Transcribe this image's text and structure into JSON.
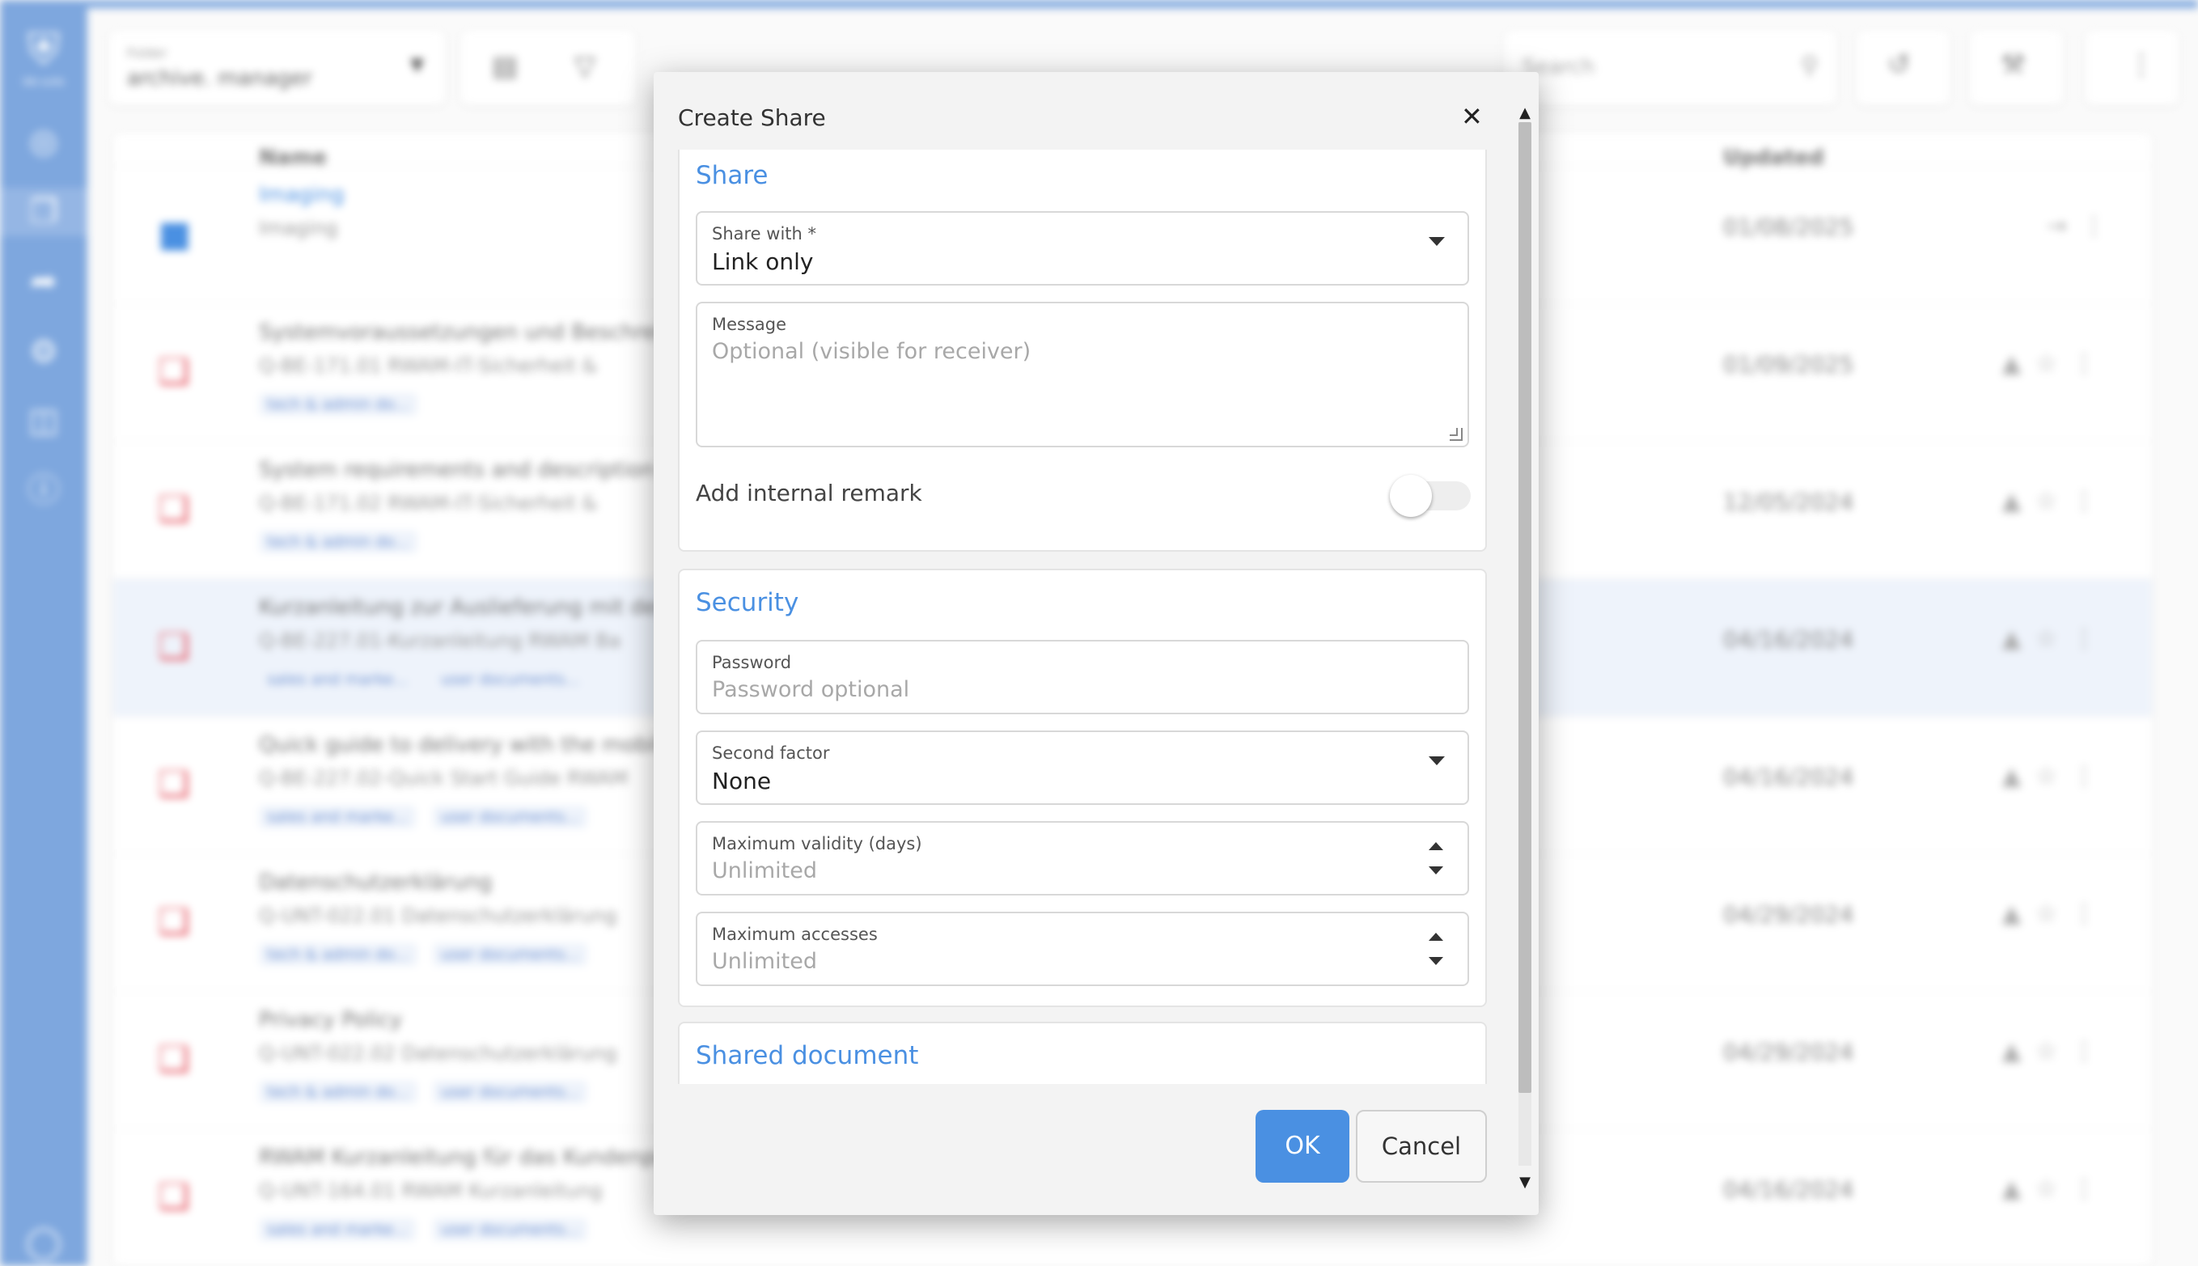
{
  "background": {
    "sidebar_logo_text": "ibb suite",
    "folder_label": "Folder",
    "folder_value": "archive. manager",
    "search_placeholder": "Search",
    "columns": {
      "name": "Name",
      "updated": "Updated"
    },
    "rows": [
      {
        "title": "Imaging",
        "subtitle": "Imaging",
        "date": "01/08/2025",
        "type": "folder",
        "tags": []
      },
      {
        "title": "Systemvoraussetzungen und Beschreibung",
        "subtitle": "Q-BE-171.01 RWAM-IT-Sicherheit &",
        "date": "01/09/2025",
        "type": "pdf",
        "tags": [
          "tech & admin do..."
        ]
      },
      {
        "title": "System requirements and description o",
        "subtitle": "Q-BE-171.02 RWAM-IT-Sicherheit &",
        "date": "12/05/2024",
        "type": "pdf",
        "tags": [
          "tech & admin do..."
        ]
      },
      {
        "title": "Kurzanleitung zur Auslieferung mit der",
        "subtitle": "Q-BE-227.01-Kurzanleitung RWAM Ba",
        "date": "04/16/2024",
        "type": "pdf",
        "tags": [
          "sales and marke...",
          "user documents..."
        ]
      },
      {
        "title": "Quick guide to delivery with the mobile",
        "subtitle": "Q-BE-227.02-Quick Start Guide RWAM",
        "date": "04/16/2024",
        "type": "pdf",
        "tags": [
          "sales and marke...",
          "user documents..."
        ]
      },
      {
        "title": "Datenschutzerklärung",
        "subtitle": "Q-UNT-022.01 Datenschutzerklärung",
        "date": "04/29/2024",
        "type": "pdf",
        "tags": [
          "tech & admin do...",
          "user documents..."
        ]
      },
      {
        "title": "Privacy Policy",
        "subtitle": "Q-UNT-022.02 Datenschutzerklärung",
        "date": "04/29/2024",
        "type": "pdf",
        "tags": [
          "tech & admin do...",
          "user documents..."
        ]
      },
      {
        "title": "RWAM Kurzanleitung für das Kundenpo",
        "subtitle": "Q-UNT-164.01 RWAM Kurzanleitung",
        "date": "04/16/2024",
        "type": "pdf",
        "tags": [
          "sales and marke...",
          "user documents..."
        ]
      }
    ]
  },
  "dialog": {
    "title": "Create Share",
    "close_icon": "close-icon",
    "share_section": {
      "title": "Share",
      "share_with_label": "Share with *",
      "share_with_value": "Link only",
      "message_label": "Message",
      "message_placeholder": "Optional (visible for receiver)",
      "internal_remark_label": "Add internal remark",
      "internal_remark_on": false
    },
    "security_section": {
      "title": "Security",
      "password_label": "Password",
      "password_placeholder": "Password optional",
      "second_factor_label": "Second factor",
      "second_factor_value": "None",
      "max_validity_label": "Maximum validity (days)",
      "max_validity_placeholder": "Unlimited",
      "max_accesses_label": "Maximum accesses",
      "max_accesses_placeholder": "Unlimited"
    },
    "shared_document_section": {
      "title": "Shared document"
    },
    "ok_label": "OK",
    "cancel_label": "Cancel"
  },
  "colors": {
    "accent": "#4a90e2",
    "sidebar": "#7ea7de",
    "pdf": "#e5535f"
  }
}
